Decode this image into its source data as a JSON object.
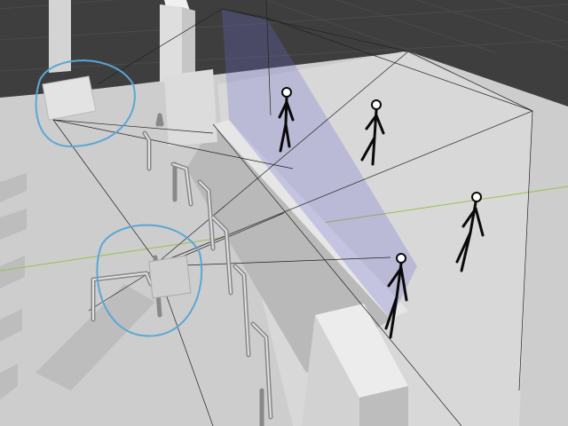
{
  "viewport": {
    "type": "3d-viewport",
    "description_colors": {
      "background_grid": "#3f3f3f",
      "floor": "#cfcfcf",
      "wall": "#e8e8e8",
      "selection_outline": "#5aa7d6",
      "x_axis_line": "#9ac04a",
      "camera_frustum_fill": "#6a6ad0",
      "figure": "#0a0a0a"
    }
  },
  "objects": {
    "cameras": [
      {
        "name": "camera-top-left",
        "selected": true
      },
      {
        "name": "camera-middle-left",
        "selected": true
      }
    ],
    "figures": [
      {
        "name": "figure-1"
      },
      {
        "name": "figure-2"
      },
      {
        "name": "figure-3"
      },
      {
        "name": "figure-4"
      }
    ]
  }
}
